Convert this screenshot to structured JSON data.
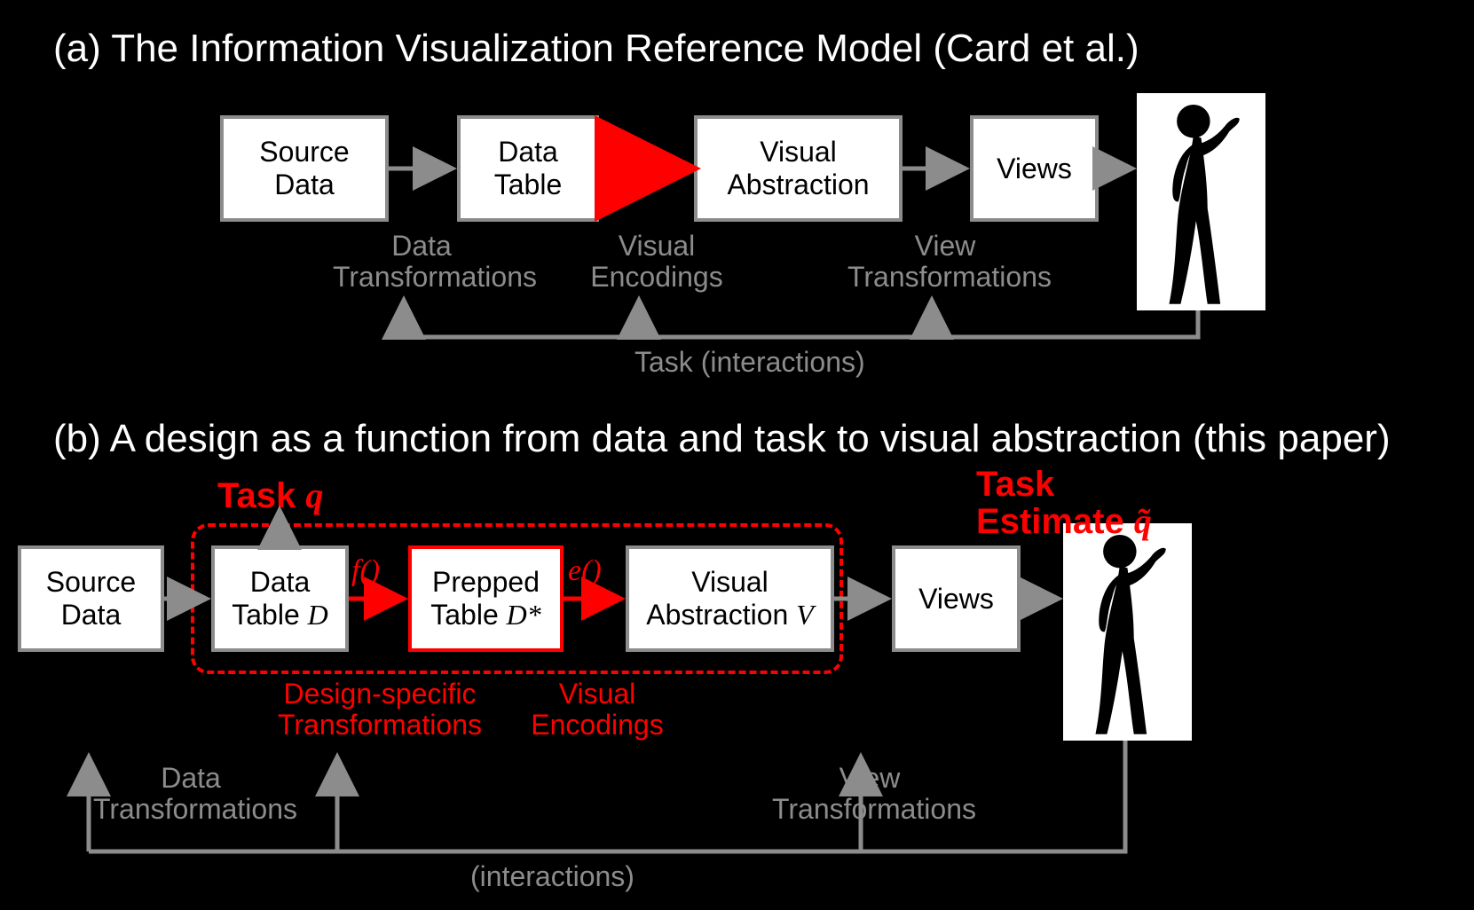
{
  "titles": {
    "a": "(a) The Information Visualization Reference Model (Card et al.)",
    "b": "(b) A design as a function from data and task to visual abstraction (this paper)"
  },
  "top": {
    "source": "Source\nData",
    "table": "Data\nTable",
    "abstraction": "Visual\nAbstraction",
    "views": "Views",
    "trans_data": "Data\nTransformations",
    "trans_visual": "Visual\nEncodings",
    "trans_view": "View\nTransformations",
    "feedback": "Task (interactions)"
  },
  "bottom": {
    "source": "Source\nData",
    "table": "Data\nTable D",
    "prepped": "Prepped\nTable D*",
    "abstraction": "Visual\nAbstraction V",
    "views": "Views",
    "task_q": "Task q",
    "task_est1": "Task",
    "task_est2": "Estimate q̃",
    "f": "f()",
    "e": "e()",
    "design_trans": "Design-specific\nTransformations",
    "visual_enc": "Visual\nEncodings",
    "bottomlbl_dt": "Data\nTransformations",
    "bottomlbl_vt": "View\nTransformations",
    "feedback": "(interactions)"
  }
}
